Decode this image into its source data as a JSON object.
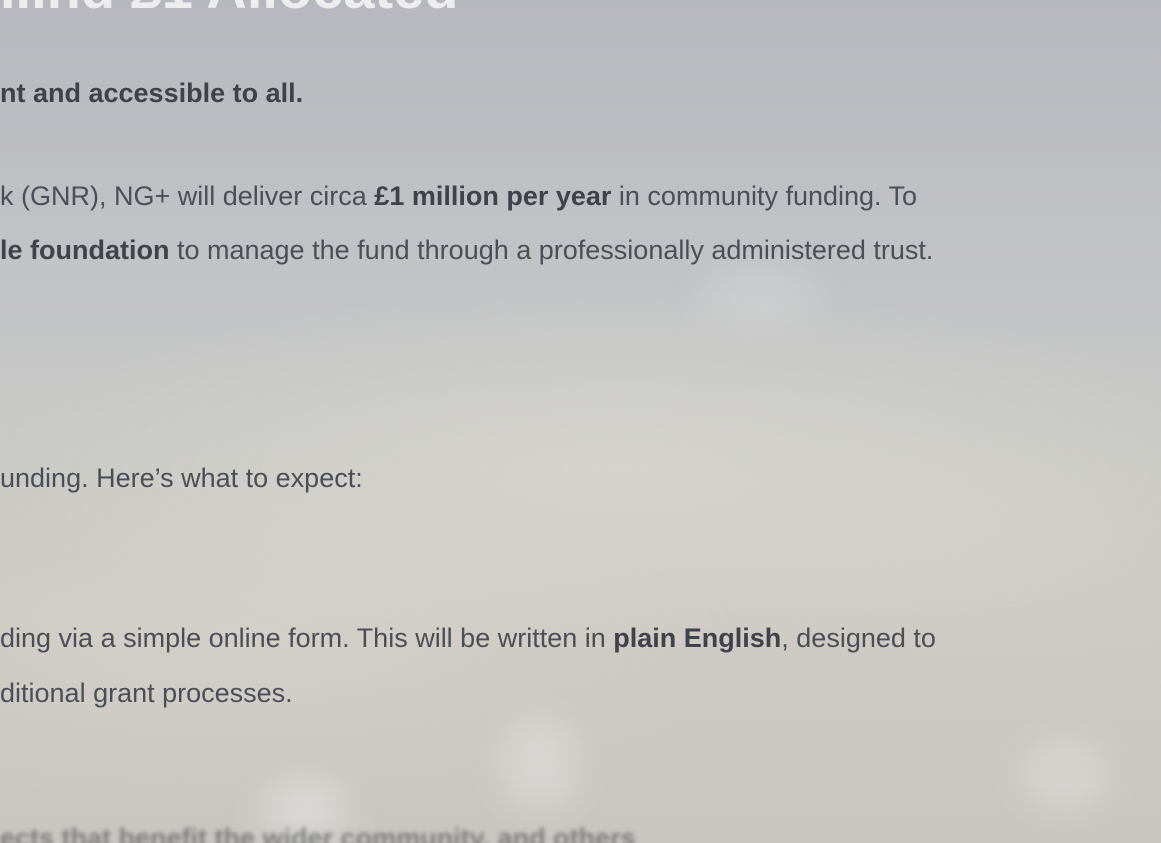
{
  "hero": {
    "heading_fragment": "...nd £1 Allocated"
  },
  "content": {
    "intro_bold": "nt and accessible to all",
    "intro_period": ".",
    "funding": {
      "part1": "k (GNR), NG+ will deliver circa ",
      "bold1": "£1 million per year",
      "part2": " in community funding. To",
      "bold2": "le foundation",
      "part3": " to manage the fund through a professionally administered trust."
    },
    "expect": "unding. Here’s what to expect:",
    "application": {
      "part1": "ding via a simple online form. This will be written in ",
      "bold1": "plain English",
      "part2": ", designed to",
      "line2": "ditional grant processes."
    },
    "cut_off_line": "ects that benefit the wider community, and others"
  },
  "colors": {
    "text": "#4b4e57",
    "bold_text": "#3f424a",
    "background_top": "#b7b8bd",
    "background_bottom": "#c8c6c0"
  }
}
